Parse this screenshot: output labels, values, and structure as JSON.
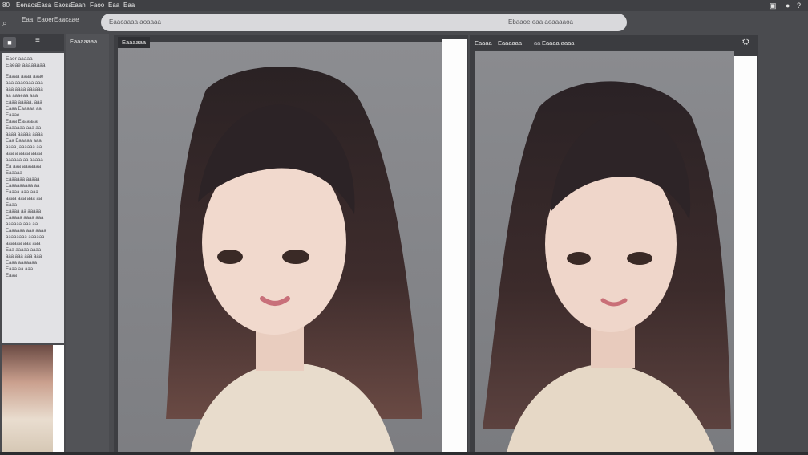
{
  "menubar": {
    "items": [
      "Eenaos",
      "Easa",
      "Eaosa",
      "Eaan",
      "Faoo",
      "Eaa",
      "Eaa"
    ],
    "left_glyph": "80",
    "right_icons": [
      "panel-icon",
      "dot-icon",
      "help-icon"
    ]
  },
  "toolbar": {
    "items": [
      "Eaa",
      "Eaoer",
      "Eaacaae"
    ]
  },
  "search": {
    "left_text": "Eaacaaaa aoaaaa",
    "center_text": "Ebaaoe eaa aeaaaaoa"
  },
  "left_panel": {
    "header_button": "■",
    "header_menu": "≡",
    "heading": "Eaer aaaaa\nEaeae aaaaaaaa",
    "text": "Eaaaa aaaa aaae\naaa aaaeaaa aaa\naaa aaaa aaaaaa\naa aaaeaa aaa\nEaaa aaaaa, aaa\nEaaa Eaaaaa aa\nEaaae\nEaaa Eaaaaaa\nEaaaaaa aaa aa\naaaa aaaaa aaaa\nEaa Eaaaaa aaa\naaaa, aaaaaa aa\naaa a aaaa aaaa\naaaaaa aa aaaaa\nEa aaa aaaaaaa\nEaaaaa\nEaaaaaa aaaaa\nEaaaaaaaaa aa\nEaaaa aaa aaa\naaaa aaa aaa aa\nEaaa\nEaaaa aa aaaaa\nEaaaaa aaaa aaa\naaaaaa aaa aa\nEaaaaaa aaa aaaa\naaaaaaaa aaaaaa\naaaaaa aaa aaa\nEaa aaaaa aaaa\naaa aaa aaa aaa\nEaaa aaaaaaa\nEaaa aa aaa\nEaaa"
  },
  "second_column": {
    "tab": "Eaaaaaaa"
  },
  "center_panel": {
    "tab": "Eaaaaaa"
  },
  "right_panel": {
    "tab1": "Eaaaa",
    "tab2": "Eaaaaaa",
    "sep": "aa",
    "tab3": "Eaaaa aaaa",
    "icon": "person-icon"
  }
}
